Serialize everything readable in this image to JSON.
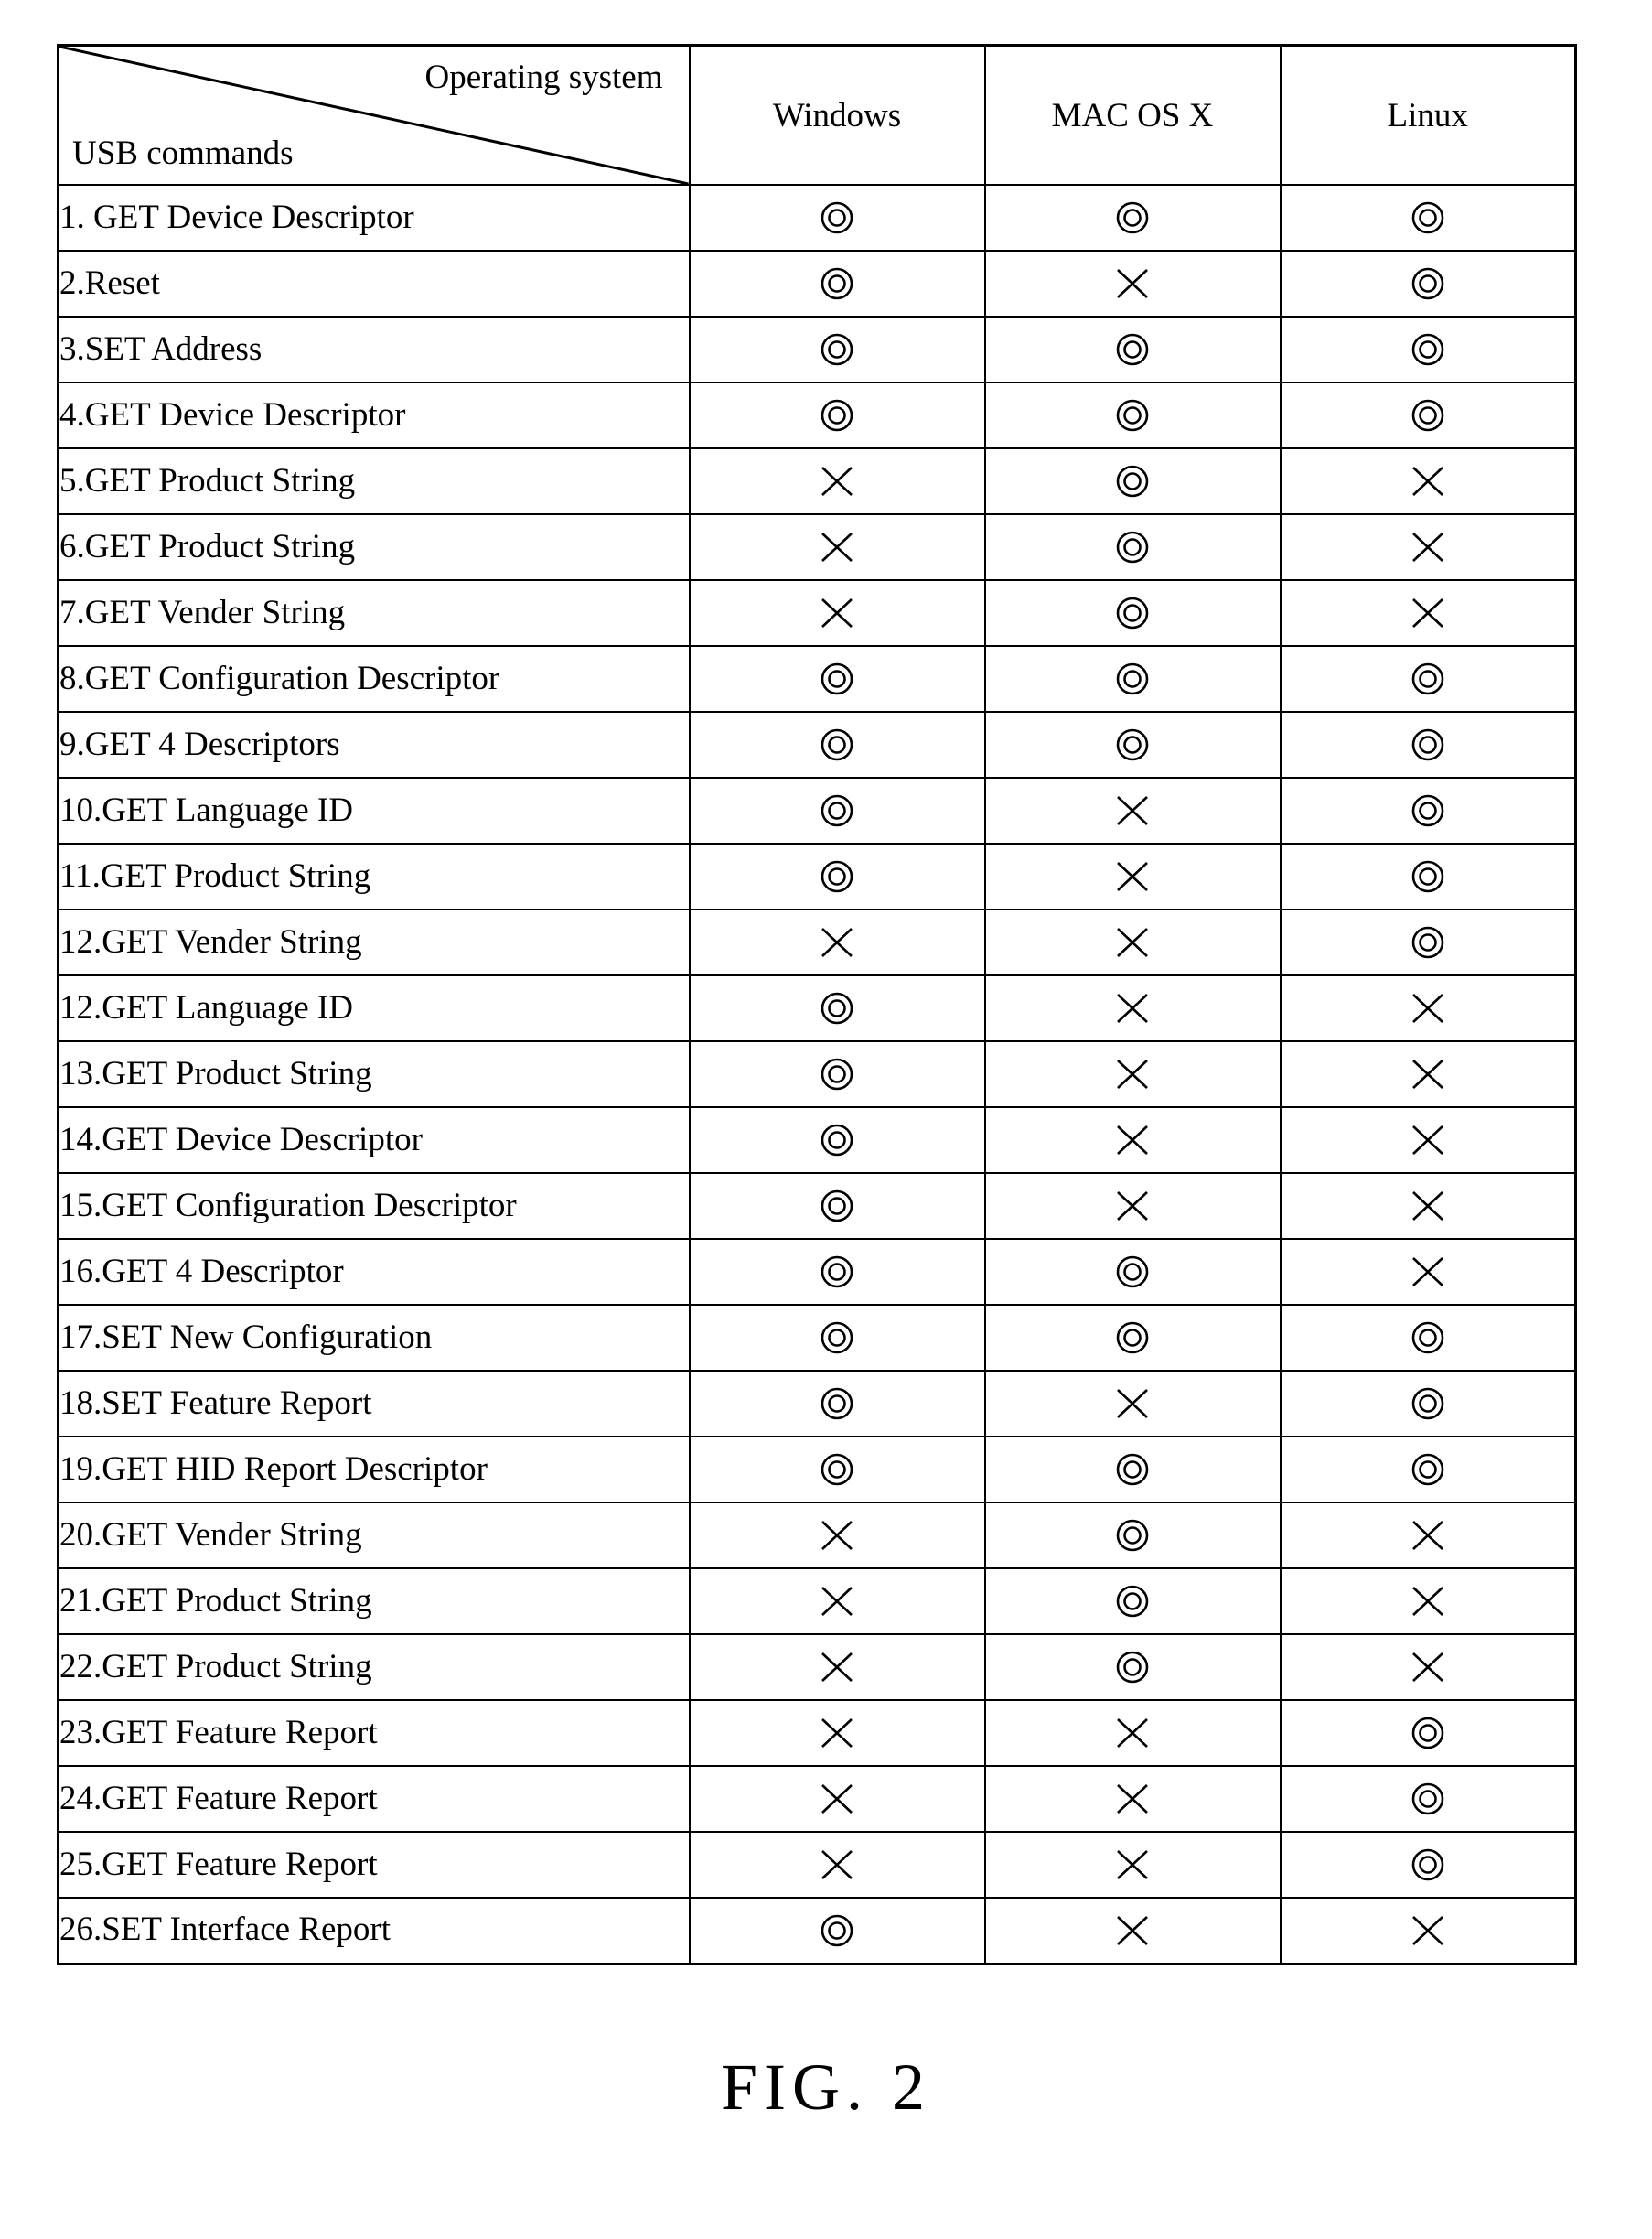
{
  "figure": {
    "caption": "FIG. 2"
  },
  "table": {
    "corner": {
      "column_axis_label": "Operating system",
      "row_axis_label": "USB commands"
    },
    "os_headers": [
      "Windows",
      "MAC OS X",
      "Linux"
    ],
    "symbols": {
      "supported": "◎",
      "unsupported": "✕",
      "supported_name": "double-circle-supported",
      "unsupported_name": "cross-unsupported"
    },
    "rows": [
      {
        "command": "1. GET Device Descriptor",
        "windows": "supported",
        "mac": "supported",
        "linux": "supported"
      },
      {
        "command": "2.Reset",
        "windows": "supported",
        "mac": "unsupported",
        "linux": "supported"
      },
      {
        "command": "3.SET Address",
        "windows": "supported",
        "mac": "supported",
        "linux": "supported"
      },
      {
        "command": "4.GET Device Descriptor",
        "windows": "supported",
        "mac": "supported",
        "linux": "supported"
      },
      {
        "command": "5.GET Product String",
        "windows": "unsupported",
        "mac": "supported",
        "linux": "unsupported"
      },
      {
        "command": "6.GET Product String",
        "windows": "unsupported",
        "mac": "supported",
        "linux": "unsupported"
      },
      {
        "command": "7.GET Vender String",
        "windows": "unsupported",
        "mac": "supported",
        "linux": "unsupported"
      },
      {
        "command": "8.GET Configuration Descriptor",
        "windows": "supported",
        "mac": "supported",
        "linux": "supported"
      },
      {
        "command": "9.GET 4 Descriptors",
        "windows": "supported",
        "mac": "supported",
        "linux": "supported"
      },
      {
        "command": "10.GET Language ID",
        "windows": "supported",
        "mac": "unsupported",
        "linux": "supported"
      },
      {
        "command": "11.GET Product String",
        "windows": "supported",
        "mac": "unsupported",
        "linux": "supported"
      },
      {
        "command": "12.GET Vender String",
        "windows": "unsupported",
        "mac": "unsupported",
        "linux": "supported"
      },
      {
        "command": "12.GET Language ID",
        "windows": "supported",
        "mac": "unsupported",
        "linux": "unsupported"
      },
      {
        "command": "13.GET Product String",
        "windows": "supported",
        "mac": "unsupported",
        "linux": "unsupported"
      },
      {
        "command": "14.GET Device Descriptor",
        "windows": "supported",
        "mac": "unsupported",
        "linux": "unsupported"
      },
      {
        "command": "15.GET Configuration Descriptor",
        "windows": "supported",
        "mac": "unsupported",
        "linux": "unsupported"
      },
      {
        "command": "16.GET 4 Descriptor",
        "windows": "supported",
        "mac": "supported",
        "linux": "unsupported"
      },
      {
        "command": "17.SET New Configuration",
        "windows": "supported",
        "mac": "supported",
        "linux": "supported"
      },
      {
        "command": "18.SET Feature Report",
        "windows": "supported",
        "mac": "unsupported",
        "linux": "supported"
      },
      {
        "command": "19.GET HID Report Descriptor",
        "windows": "supported",
        "mac": "supported",
        "linux": "supported"
      },
      {
        "command": "20.GET Vender String",
        "windows": "unsupported",
        "mac": "supported",
        "linux": "unsupported"
      },
      {
        "command": "21.GET Product String",
        "windows": "unsupported",
        "mac": "supported",
        "linux": "unsupported"
      },
      {
        "command": "22.GET Product String",
        "windows": "unsupported",
        "mac": "supported",
        "linux": "unsupported"
      },
      {
        "command": "23.GET Feature Report",
        "windows": "unsupported",
        "mac": "unsupported",
        "linux": "supported"
      },
      {
        "command": "24.GET Feature Report",
        "windows": "unsupported",
        "mac": "unsupported",
        "linux": "supported"
      },
      {
        "command": "25.GET Feature Report",
        "windows": "unsupported",
        "mac": "unsupported",
        "linux": "supported"
      },
      {
        "command": "26.SET Interface Report",
        "windows": "supported",
        "mac": "unsupported",
        "linux": "unsupported"
      }
    ]
  }
}
